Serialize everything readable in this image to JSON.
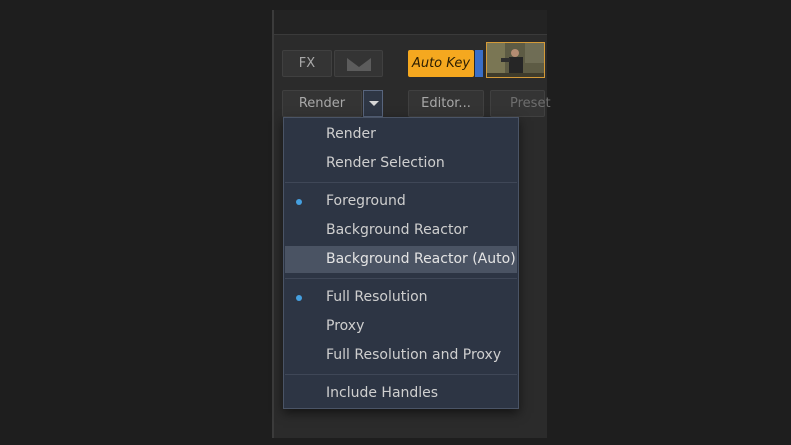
{
  "toolbar": {
    "fx_label": "FX",
    "auto_key_label": "Auto Key",
    "render_label": "Render",
    "editor_label": "Editor...",
    "preset_label": "Preset",
    "accent_color": "#f5a81f"
  },
  "menu": {
    "items": [
      {
        "label": "Render",
        "selected": false,
        "highlighted": false
      },
      {
        "label": "Render Selection",
        "selected": false,
        "highlighted": false
      },
      {
        "label": "Foreground",
        "selected": true,
        "highlighted": false
      },
      {
        "label": "Background Reactor",
        "selected": false,
        "highlighted": false
      },
      {
        "label": "Background Reactor (Auto)",
        "selected": false,
        "highlighted": true
      },
      {
        "label": "Full Resolution",
        "selected": true,
        "highlighted": false
      },
      {
        "label": "Proxy",
        "selected": false,
        "highlighted": false
      },
      {
        "label": "Full Resolution and Proxy",
        "selected": false,
        "highlighted": false
      },
      {
        "label": "Include Handles",
        "selected": false,
        "highlighted": false
      }
    ],
    "selection_dot_color": "#45a0e0"
  }
}
